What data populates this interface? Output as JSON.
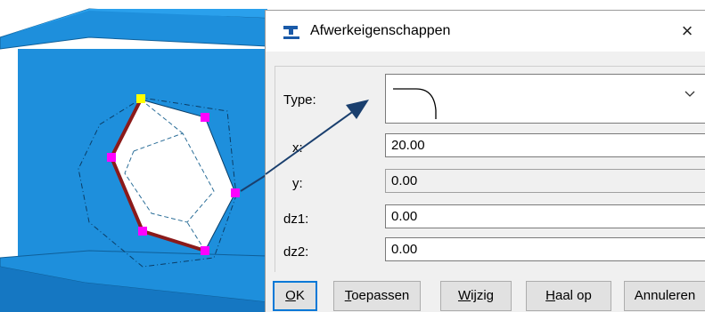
{
  "dialog": {
    "title": "Afwerkeigenschappen",
    "close_glyph": "×",
    "fields": {
      "type_label": "Type:",
      "x_label": "x:",
      "x_value": "20.00",
      "y_label": "y:",
      "y_value": "0.00",
      "dz1_label": "dz1:",
      "dz1_value": "0.00",
      "dz2_label": "dz2:",
      "dz2_value": "0.00"
    },
    "buttons": {
      "ok_mn": "O",
      "ok_rest": "K",
      "apply_mn": "T",
      "apply_rest": "oepassen",
      "modify_mn": "W",
      "modify_rest": "ijzig",
      "get_mn": "H",
      "get_rest": "aal op",
      "cancel": "Annuleren"
    },
    "icons": {
      "app": "tekla-app-icon",
      "close": "close-icon",
      "dropdown": "chevron-down-icon",
      "type_preview": "rounded-corner-preview-icon"
    }
  },
  "colors": {
    "steel": "#1e8fdc",
    "steel_dark": "#1577c2",
    "handle": "#ff00ff",
    "selected_handle": "#ffff00",
    "edge_highlight": "#8b1a1a",
    "leader_arrow": "#1a3f6e",
    "default_button_border": "#0078d7"
  }
}
